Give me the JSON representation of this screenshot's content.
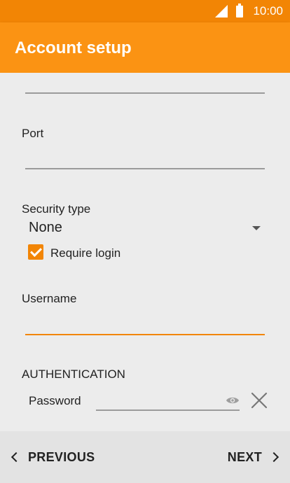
{
  "status_bar": {
    "time": "10:00"
  },
  "app_bar": {
    "title": "Account setup"
  },
  "form": {
    "port_label": "Port",
    "port_value": "",
    "security_label": "Security type",
    "security_value": "None",
    "require_login_label": "Require login",
    "require_login_checked": true,
    "username_label": "Username",
    "username_value": "",
    "authentication_heading": "AUTHENTICATION",
    "password_label": "Password",
    "password_value": ""
  },
  "nav": {
    "previous_label": "PREVIOUS",
    "next_label": "NEXT"
  },
  "colors": {
    "accent": "#f28505",
    "app_bar": "#fb9313",
    "background": "#ececec"
  }
}
